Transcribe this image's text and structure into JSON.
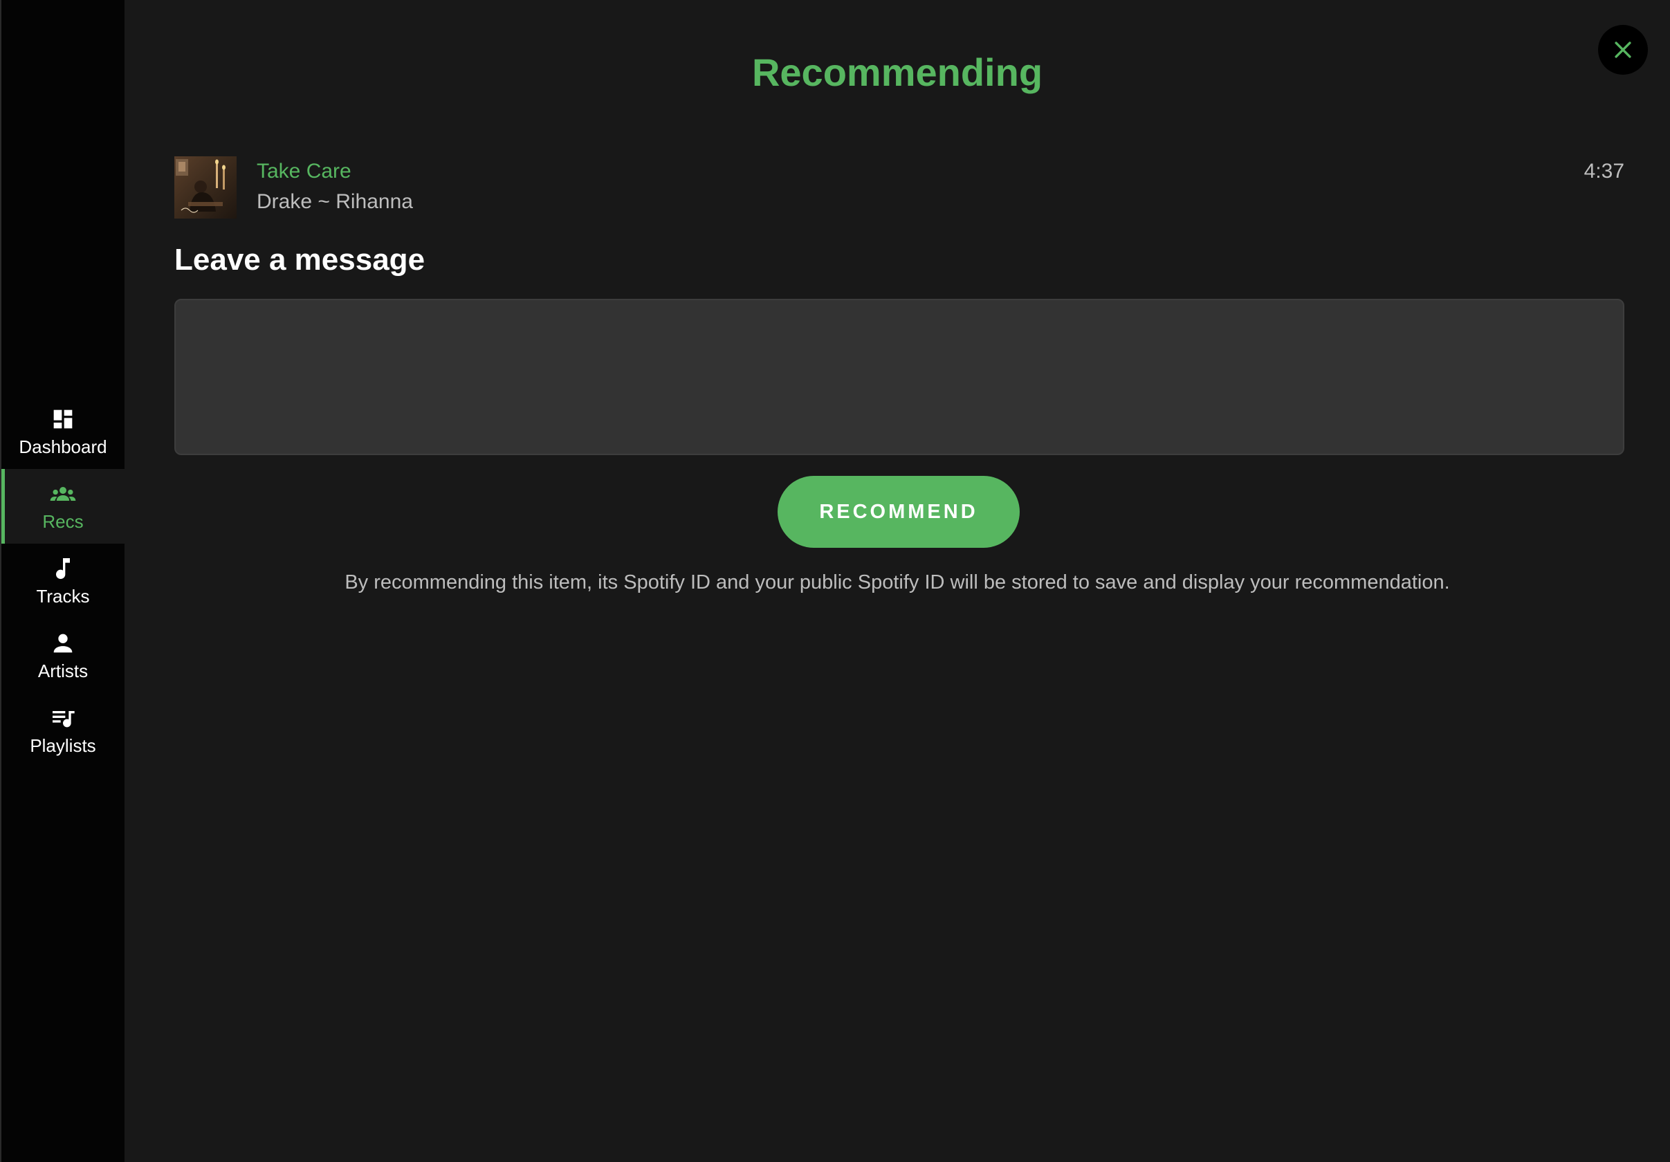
{
  "sidebar": {
    "items": [
      {
        "label": "Dashboard",
        "icon": "dashboard-icon",
        "active": false
      },
      {
        "label": "Recs",
        "icon": "people-icon",
        "active": true
      },
      {
        "label": "Tracks",
        "icon": "music-note-icon",
        "active": false
      },
      {
        "label": "Artists",
        "icon": "person-icon",
        "active": false
      },
      {
        "label": "Playlists",
        "icon": "playlist-icon",
        "active": false
      }
    ]
  },
  "modal": {
    "title": "Recommending",
    "close_icon": "close-icon"
  },
  "track": {
    "title": "Take Care",
    "artists": "Drake ~ Rihanna",
    "duration": "4:37",
    "art_icon": "album-art"
  },
  "message": {
    "heading": "Leave a message",
    "value": "",
    "placeholder": ""
  },
  "actions": {
    "recommend_label": "RECOMMEND"
  },
  "disclaimer": "By recommending this item, its Spotify ID and your public Spotify ID will be stored to save and display your recommendation.",
  "colors": {
    "accent": "#57b660",
    "background": "#181818",
    "sidebar": "#040404",
    "input": "#333333",
    "muted_text": "#bdbdbd"
  }
}
